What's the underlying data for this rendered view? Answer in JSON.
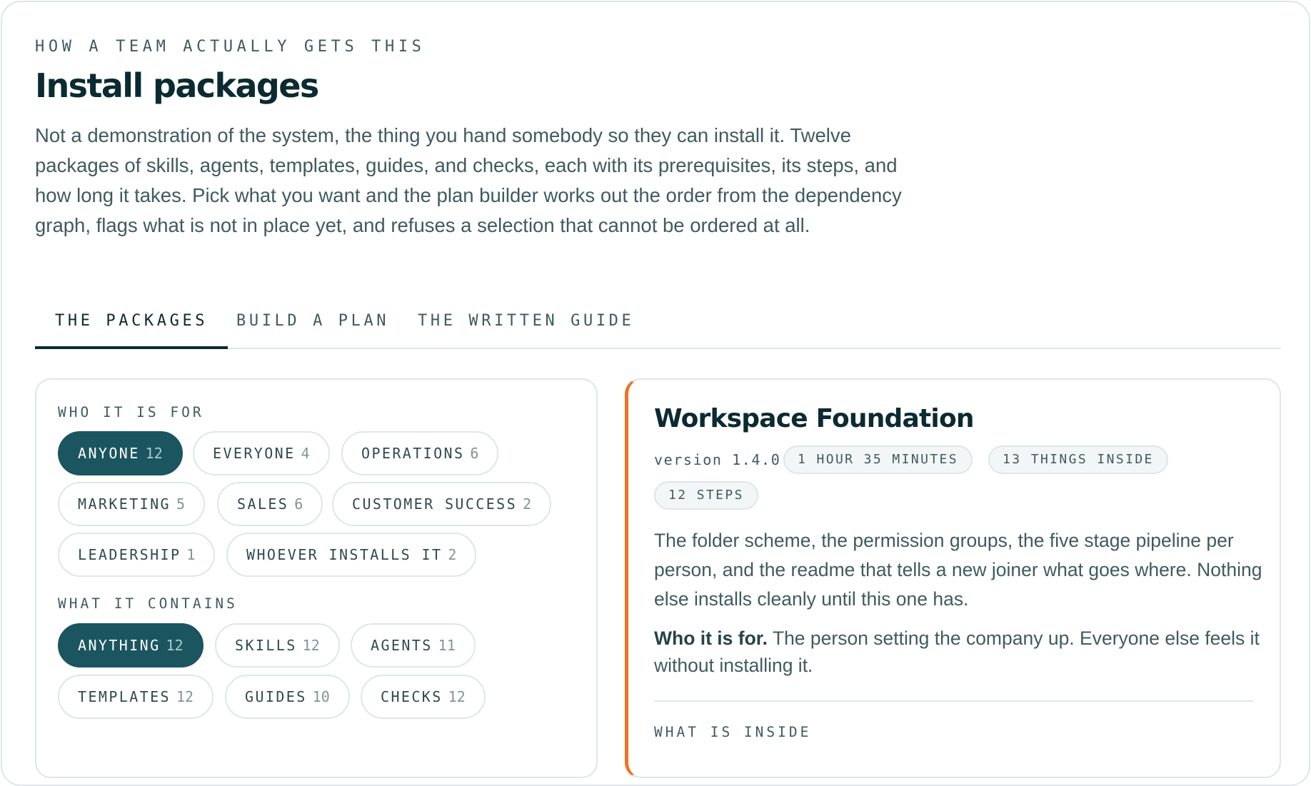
{
  "header": {
    "eyebrow": "HOW A TEAM ACTUALLY GETS THIS",
    "title": "Install packages",
    "lede": "Not a demonstration of the system, the thing you hand somebody so they can install it. Twelve packages of skills, agents, templates, guides, and checks, each with its prerequisites, its steps, and how long it takes. Pick what you want and the plan builder works out the order from the dependency graph, flags what is not in place yet, and refuses a selection that cannot be ordered at all."
  },
  "tabs": [
    {
      "label": "THE PACKAGES",
      "active": true
    },
    {
      "label": "BUILD A PLAN",
      "active": false
    },
    {
      "label": "THE WRITTEN GUIDE",
      "active": false
    }
  ],
  "filters": {
    "audience": {
      "label": "WHO IT IS FOR",
      "chips": [
        {
          "label": "ANYONE",
          "count": "12",
          "selected": true
        },
        {
          "label": "EVERYONE",
          "count": "4",
          "selected": false
        },
        {
          "label": "OPERATIONS",
          "count": "6",
          "selected": false
        },
        {
          "label": "MARKETING",
          "count": "5",
          "selected": false
        },
        {
          "label": "SALES",
          "count": "6",
          "selected": false
        },
        {
          "label": "CUSTOMER SUCCESS",
          "count": "2",
          "selected": false
        },
        {
          "label": "LEADERSHIP",
          "count": "1",
          "selected": false
        },
        {
          "label": "WHOEVER INSTALLS IT",
          "count": "2",
          "selected": false
        }
      ]
    },
    "contents": {
      "label": "WHAT IT CONTAINS",
      "chips": [
        {
          "label": "ANYTHING",
          "count": "12",
          "selected": true
        },
        {
          "label": "SKILLS",
          "count": "12",
          "selected": false
        },
        {
          "label": "AGENTS",
          "count": "11",
          "selected": false
        },
        {
          "label": "TEMPLATES",
          "count": "12",
          "selected": false
        },
        {
          "label": "GUIDES",
          "count": "10",
          "selected": false
        },
        {
          "label": "CHECKS",
          "count": "12",
          "selected": false
        }
      ]
    }
  },
  "package": {
    "title": "Workspace Foundation",
    "version": "version 1.4.0",
    "badges": [
      "1 HOUR 35 MINUTES",
      "13 THINGS INSIDE",
      "12 STEPS"
    ],
    "description": "The folder scheme, the permission groups, the five stage pipeline per person, and the readme that tells a new joiner what goes where. Nothing else installs cleanly until this one has.",
    "who_label": "Who it is for.",
    "who_text": " The person setting the company up. Everyone else feels it without installing it.",
    "inside_label": "WHAT IS INSIDE"
  },
  "colors": {
    "accent": "#f07226",
    "selected_chip": "#1b5560",
    "border": "#dfe6e7"
  }
}
